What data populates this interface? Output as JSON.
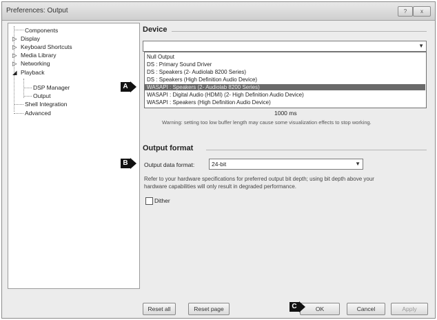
{
  "window": {
    "title": "Preferences: Output",
    "buttons": [
      "?",
      "x"
    ]
  },
  "tree": {
    "items": [
      {
        "label": "Components"
      },
      {
        "label": "Display"
      },
      {
        "label": "Keyboard Shortcuts"
      },
      {
        "label": "Media Library"
      },
      {
        "label": "Networking"
      },
      {
        "label": "Playback"
      },
      {
        "label": "DSP Manager"
      },
      {
        "label": "Output"
      },
      {
        "label": "Shell Integration"
      },
      {
        "label": "Advanced"
      }
    ]
  },
  "device": {
    "section_title": "Device",
    "options": [
      "Null Output",
      "DS : Primary Sound Driver",
      "DS : Speakers (2- Audiolab 8200 Series)",
      "DS : Speakers (High Definition Audio Device)",
      "WASAPI : Speakers (2- Audiolab 8200 Series)",
      "WASAPI : Digital Audio (HDMI) (2- High Definition Audio Device)",
      "WASAPI : Speakers (High Definition Audio Device)"
    ],
    "selected_index": 4,
    "buffer_value": "1000 ms",
    "warning": "Warning: setting too low buffer length may cause some visualization effects to stop working."
  },
  "output_format": {
    "section_title": "Output format",
    "data_format_label": "Output data format:",
    "data_format_value": "24-bit",
    "help_text_1": "Refer to your hardware specifications for preferred output bit depth; using bit depth above your",
    "help_text_2": "hardware capabilities will only result in degraded performance.",
    "dither_label": "Dither",
    "dither_checked": false
  },
  "footer": {
    "reset_all": "Reset all",
    "reset_page": "Reset page",
    "ok": "OK",
    "cancel": "Cancel",
    "apply": "Apply"
  },
  "callouts": {
    "a": "A",
    "b": "B",
    "c": "C"
  },
  "colors": {
    "selection": "#6a6a6a",
    "callout": "#111111"
  }
}
